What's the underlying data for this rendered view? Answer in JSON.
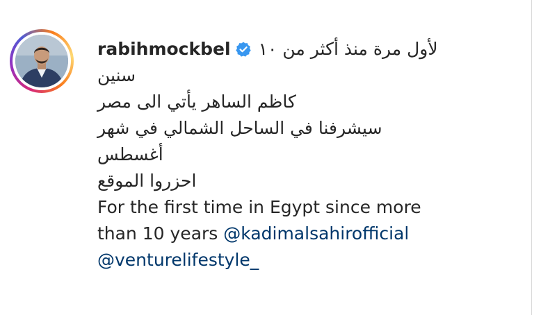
{
  "post": {
    "username": "rabihmockbel",
    "verified_icon": "verified-badge-icon",
    "colors": {
      "text": "#262626",
      "mention": "#00376b",
      "verified": "#3897f0",
      "story_ring": [
        "#feda75",
        "#fa7e1e",
        "#d62976",
        "#962fbf",
        "#4f5bd5"
      ]
    },
    "caption": {
      "line1_ar": "لأول مرة منذ أكثر من ١٠",
      "line2_ar": "سنين",
      "line3_ar": "كاظم الساهر يأتي الى مصر",
      "line4_ar": "سيشرفنا في الساحل الشمالي في شهر",
      "line5_ar": "أغسطس",
      "line6_ar": "احزروا الموقع",
      "line7_en": "For the first time in Egypt since more",
      "line8_en": "than 10 years",
      "mention1": "@kadimalsahirofficial",
      "mention2": "@venturelifestyle_"
    }
  }
}
